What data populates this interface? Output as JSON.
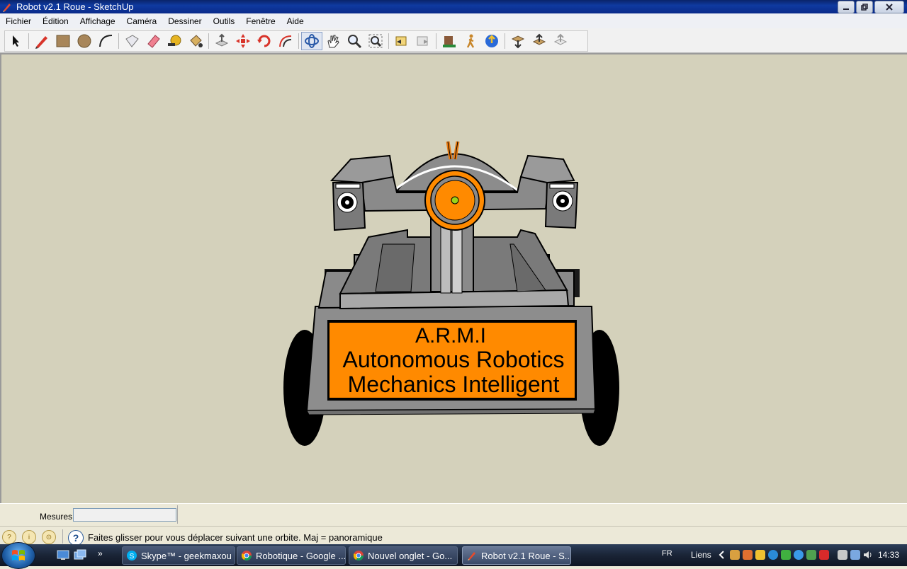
{
  "window": {
    "title": "Robot v2.1 Roue - SketchUp"
  },
  "menu": [
    "Fichier",
    "Édition",
    "Affichage",
    "Caméra",
    "Dessiner",
    "Outils",
    "Fenêtre",
    "Aide"
  ],
  "toolbar": {
    "tools": [
      "select-tool",
      "pencil-tool",
      "rectangle-tool",
      "circle-tool",
      "arc-tool",
      "make-component-tool",
      "eraser-tool",
      "tape-measure-tool",
      "paint-bucket-tool",
      "push-pull-tool",
      "move-tool",
      "rotate-tool",
      "offset-tool",
      "orbit-tool",
      "pan-tool",
      "zoom-tool",
      "zoom-extents-tool",
      "previous-view-tool",
      "next-view-tool",
      "position-camera-tool",
      "walk-tool",
      "look-around-tool",
      "get-models-tool",
      "share-model-tool",
      "share-component-tool"
    ]
  },
  "model": {
    "sign_line1": "A.R.M.I",
    "sign_line2": "Autonomous Robotics",
    "sign_line3": "Mechanics Intelligent",
    "colors": {
      "background": "#d4d1bb",
      "body": "#8c8c8c",
      "orange": "#ff8a00",
      "wheel": "#000000"
    }
  },
  "vcb": {
    "label": "Mesures",
    "value": ""
  },
  "status": {
    "text": "Faites glisser pour vous déplacer suivant une orbite.  Maj = panoramique"
  },
  "taskbar": {
    "tasks": [
      {
        "label": "Skype™ - geekmaxou",
        "icon": "skype-icon"
      },
      {
        "label": "Robotique - Google ...",
        "icon": "chrome-icon"
      },
      {
        "label": "Nouvel onglet - Go...",
        "icon": "chrome-icon"
      },
      {
        "label": "Robot v2.1 Roue - S...",
        "icon": "sketchup-icon",
        "active": true
      }
    ],
    "lang": "FR",
    "liens": "Liens",
    "clock": "14:33"
  }
}
